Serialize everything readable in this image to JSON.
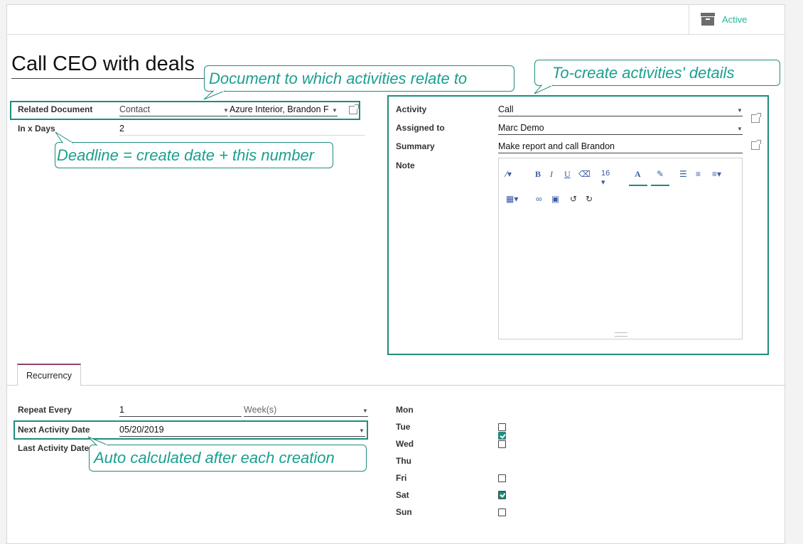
{
  "header": {
    "active_label": "Active",
    "archive_icon": "archive-icon"
  },
  "record": {
    "title": "Call CEO with deals"
  },
  "left_fields": {
    "related_document": {
      "label": "Related Document",
      "model": "Contact",
      "record": "Azure Interior, Brandon F"
    },
    "in_x_days": {
      "label": "In x Days",
      "value": "2"
    }
  },
  "activity_details": {
    "activity": {
      "label": "Activity",
      "value": "Call"
    },
    "assigned_to": {
      "label": "Assigned to",
      "value": "Marc Demo"
    },
    "summary": {
      "label": "Summary",
      "value": "Make report and call Brandon"
    },
    "note": {
      "label": "Note"
    }
  },
  "editor_toolbar": {
    "font_size": "16",
    "bold": "B",
    "italic": "I",
    "underline": "U",
    "font_color": "A"
  },
  "tabs": [
    {
      "label": "Recurrency"
    }
  ],
  "recurrency": {
    "repeat_every": {
      "label": "Repeat Every",
      "value": "1",
      "unit": "Week(s)"
    },
    "next_activity_date": {
      "label": "Next Activity Date",
      "value": "05/20/2019"
    },
    "last_activity_date": {
      "label": "Last Activity Date"
    }
  },
  "weekdays": [
    {
      "label": "Mon",
      "checked": true
    },
    {
      "label": "Tue",
      "checked": false
    },
    {
      "label": "Wed",
      "checked": false
    },
    {
      "label": "Thu",
      "checked": true
    },
    {
      "label": "Fri",
      "checked": false
    },
    {
      "label": "Sat",
      "checked": false
    },
    {
      "label": "Sun",
      "checked": false
    }
  ],
  "annotations": {
    "document": "Document to which activities relate to",
    "details": "To-create activities' details",
    "deadline": "Deadline = create date + this number",
    "auto": "Auto calculated after each creation"
  },
  "colors": {
    "accent": "#1f8c7c",
    "active": "#21b799",
    "tab_border": "#8e4466"
  }
}
